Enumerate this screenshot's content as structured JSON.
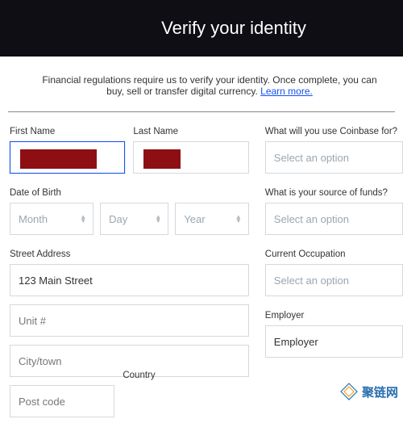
{
  "header": {
    "title": "Verify your identity"
  },
  "intro": {
    "text_1": "Financial regulations require us to verify your identity. Once complete, you can",
    "text_2": "buy, sell or transfer digital currency.",
    "learn_more": "Learn more."
  },
  "left": {
    "first_name_label": "First Name",
    "last_name_label": "Last Name",
    "dob_label": "Date of Birth",
    "dob": {
      "month": "Month",
      "day": "Day",
      "year": "Year"
    },
    "address_label": "Street Address",
    "address": {
      "street": "123 Main Street",
      "unit": "Unit #",
      "city": "City/town",
      "post": "Post code"
    },
    "country_label": "Country"
  },
  "right": {
    "use_label": "What will you use Coinbase for?",
    "funds_label": "What is your source of funds?",
    "occupation_label": "Current Occupation",
    "employer_label": "Employer",
    "select_placeholder": "Select an option",
    "employer_placeholder": "Employer"
  },
  "watermark": "聚链网"
}
